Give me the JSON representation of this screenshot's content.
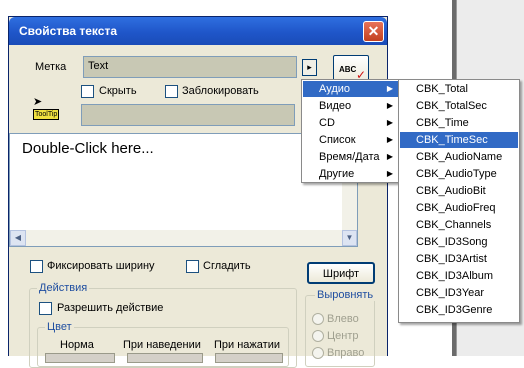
{
  "window": {
    "title": "Свойства текста",
    "close_label": "✕"
  },
  "label_section": {
    "label": "Метка",
    "text_value": "Text",
    "arrow_label": "▸",
    "abc_label": "ABC",
    "hide_label": "Скрыть",
    "lock_label": "Заблокировать",
    "tooltip_label": "ToolTip"
  },
  "editor": {
    "placeholder_text": "Double-Click here..."
  },
  "options": {
    "fixed_width": "Фиксировать ширину",
    "smooth": "Сгладить",
    "font_button": "Шрифт"
  },
  "actions": {
    "group_title": "Действия",
    "allow_action": "Разрешить действие"
  },
  "align": {
    "group_title": "Выровнять",
    "left": "Влево",
    "center": "Центр",
    "right": "Вправо"
  },
  "color": {
    "group_title": "Цвет",
    "normal": "Норма",
    "hover": "При наведении",
    "pressed": "При нажатии"
  },
  "menu_main": {
    "items": [
      "Аудио",
      "Видео",
      "CD",
      "Список",
      "Время/Дата",
      "Другие"
    ],
    "selected": "Аудио"
  },
  "menu_audio": {
    "items": [
      "CBK_Total",
      "CBK_TotalSec",
      "CBK_Time",
      "CBK_TimeSec",
      "CBK_AudioName",
      "CBK_AudioType",
      "CBK_AudioBit",
      "CBK_AudioFreq",
      "CBK_Channels",
      "CBK_ID3Song",
      "CBK_ID3Artist",
      "CBK_ID3Album",
      "CBK_ID3Year",
      "CBK_ID3Genre"
    ],
    "selected": "CBK_TimeSec"
  },
  "colors": {
    "title_bar": "#1f56c9",
    "dialog_bg": "#ece9d8",
    "selection": "#316ac5"
  }
}
